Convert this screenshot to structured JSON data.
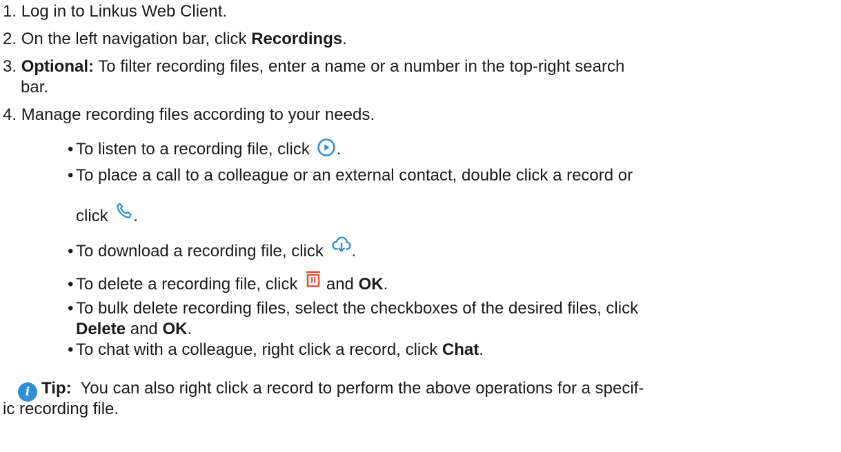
{
  "steps": [
    {
      "num": "1.",
      "text": "Log in to Linkus Web Client."
    },
    {
      "num": "2.",
      "pre": "On the left navigation bar, click ",
      "bold": "Recordings",
      "post": "."
    },
    {
      "num": "3.",
      "bold": "Optional:",
      "text": " To filter recording files, enter a name or a number in the top-right search",
      "cont": "bar."
    },
    {
      "num": "4.",
      "text": "Manage recording files according to your needs."
    }
  ],
  "bullets": {
    "listen": {
      "pre": "To listen to a recording file, click",
      "post": "."
    },
    "call": {
      "pre": "To place a call to a colleague or an external contact, double click a record or",
      "cont": "click",
      "post": "."
    },
    "download": {
      "pre": "To download a recording file, click",
      "post": "."
    },
    "delete": {
      "pre": "To delete a recording file, click",
      "mid": " and ",
      "bold": "OK",
      "post": "."
    },
    "bulk": {
      "pre": "To bulk delete recording files, select the checkboxes of the desired files, click",
      "bold1": "Delete",
      "mid": " and ",
      "bold2": "OK",
      "post": "."
    },
    "chat": {
      "pre": "To chat with a colleague, right click a record, click ",
      "bold": "Chat",
      "post": "."
    }
  },
  "tip": {
    "icon_letter": "i",
    "label": "Tip:",
    "text": "  You can also right click a record to perform the above operations for a specif-",
    "cont": "ic recording file."
  },
  "bullet_char": "•",
  "colors": {
    "icon_blue": "#2f8fd6",
    "icon_red": "#e0523b",
    "text": "#1a1a1a"
  },
  "icons": {
    "listen": "play-circle-icon",
    "call": "phone-icon",
    "download": "cloud-download-icon",
    "delete": "trash-icon",
    "tip": "info-icon"
  }
}
